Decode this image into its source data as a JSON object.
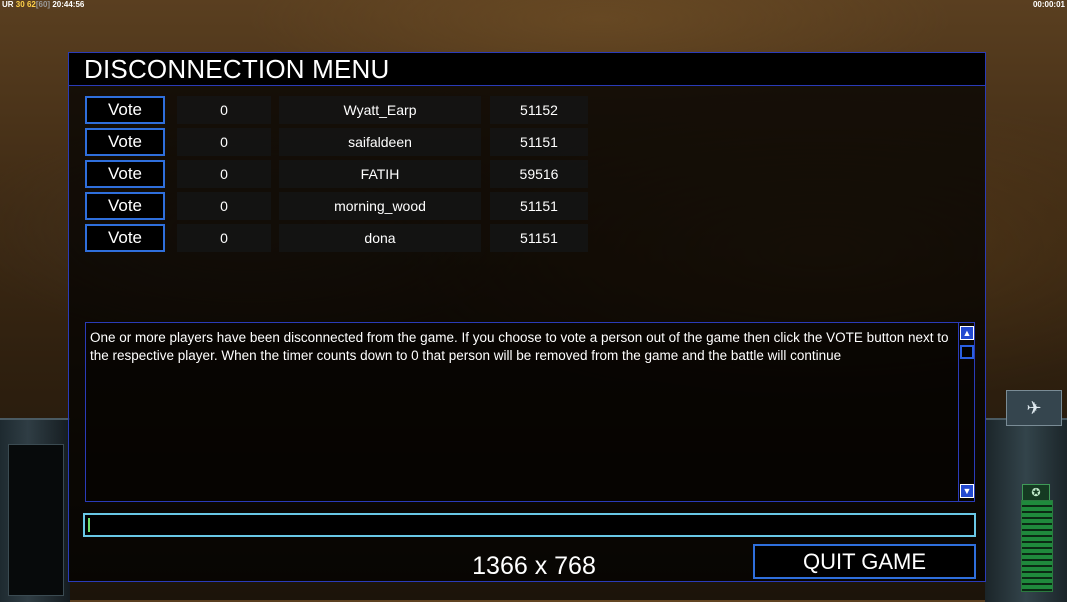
{
  "hud": {
    "left_prefix": "UR",
    "left_a": "30",
    "left_b": "62",
    "left_c": "60",
    "left_time": "20:44:56",
    "right_time": "00:00:01"
  },
  "dialog": {
    "title": "DISCONNECTION MENU",
    "vote_label": "Vote",
    "players": [
      {
        "count": "0",
        "name": "Wyatt_Earp",
        "ping": "51152"
      },
      {
        "count": "0",
        "name": "saifaldeen",
        "ping": "51151"
      },
      {
        "count": "0",
        "name": "FATIH",
        "ping": "59516"
      },
      {
        "count": "0",
        "name": "morning_wood",
        "ping": "51151"
      },
      {
        "count": "0",
        "name": "dona",
        "ping": "51151"
      }
    ],
    "message": "One or more players have been disconnected from the game. If you choose to vote a person out of the game then click the VOTE button next to the respective player. When the timer counts down to 0 that person will be removed from the game and the battle will continue",
    "resolution": "1366 x 768",
    "quit_label": "QUIT GAME"
  },
  "icons": {
    "scroll_up": "triangle-up-icon",
    "scroll_down": "triangle-down-icon"
  },
  "colors": {
    "border_blue": "#2a3bb8",
    "button_blue": "#2f6fdc",
    "chat_border": "#69c7e6"
  }
}
